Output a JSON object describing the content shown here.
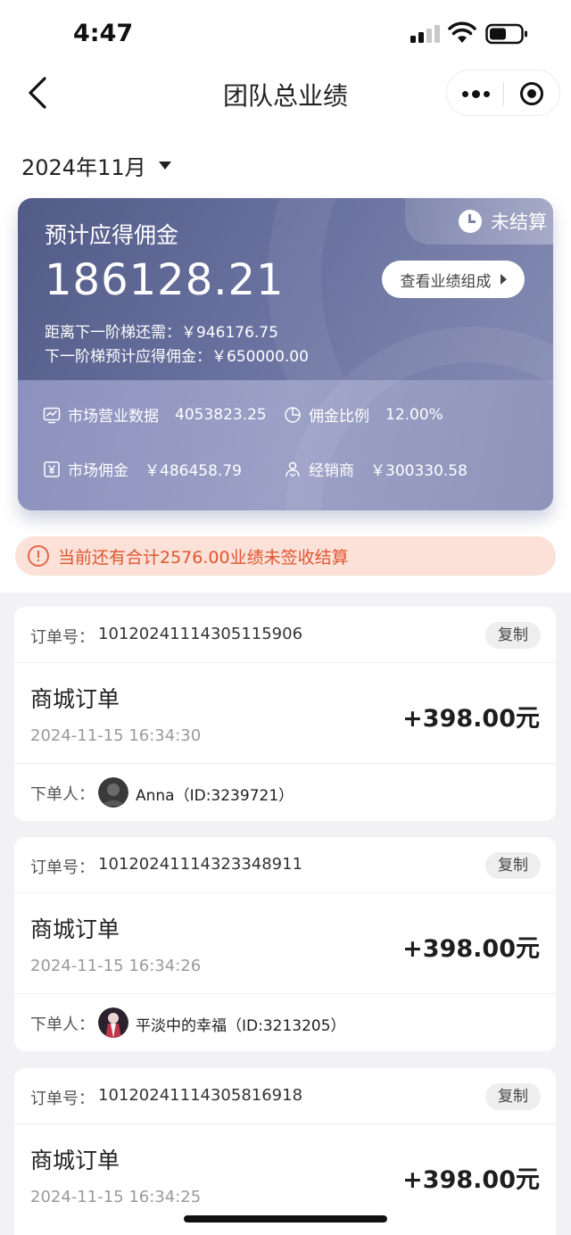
{
  "status_bar": {
    "time": "4:47"
  },
  "nav": {
    "title": "团队总业绩"
  },
  "month_selector": {
    "label": "2024年11月"
  },
  "commission_card": {
    "status_tag": "未结算",
    "estimate_label": "预计应得佣金",
    "estimate_amount": "186128.21",
    "view_button": "查看业绩组成",
    "gap_to_next_tier": "距离下一阶梯还需：￥946176.75",
    "next_tier_commission": "下一阶梯预计应得佣金：￥650000.00",
    "stats": [
      {
        "label": "市场营业数据",
        "value": "4053823.25",
        "icon": "chart-icon"
      },
      {
        "label": "佣金比例",
        "value": "12.00%",
        "icon": "pie-icon"
      },
      {
        "label": "市场佣金",
        "value": "￥486458.79",
        "icon": "yen-icon"
      },
      {
        "label": "经销商",
        "value": "￥300330.58",
        "icon": "users-icon"
      }
    ]
  },
  "alert": {
    "text": "当前还有合计2576.00业绩未签收结算"
  },
  "orders": [
    {
      "order_no_label": "订单号：",
      "order_no": "10120241114305115906",
      "copy_label": "复制",
      "type": "商城订单",
      "date": "2024-11-15 16:34:30",
      "amount": "+398.00元",
      "buyer_label": "下单人：",
      "buyer": "Anna（ID:3239721）"
    },
    {
      "order_no_label": "订单号：",
      "order_no": "10120241114323348911",
      "copy_label": "复制",
      "type": "商城订单",
      "date": "2024-11-15 16:34:26",
      "amount": "+398.00元",
      "buyer_label": "下单人：",
      "buyer": "平淡中的幸福（ID:3213205）"
    },
    {
      "order_no_label": "订单号：",
      "order_no": "10120241114305816918",
      "copy_label": "复制",
      "type": "商城订单",
      "date": "2024-11-15 16:34:25",
      "amount": "+398.00元"
    }
  ],
  "colors": {
    "card_gradient_start": "#525a86",
    "card_gradient_end": "#8a90b6",
    "alert_bg": "#fbe1d8",
    "alert_text": "#e0552f"
  }
}
